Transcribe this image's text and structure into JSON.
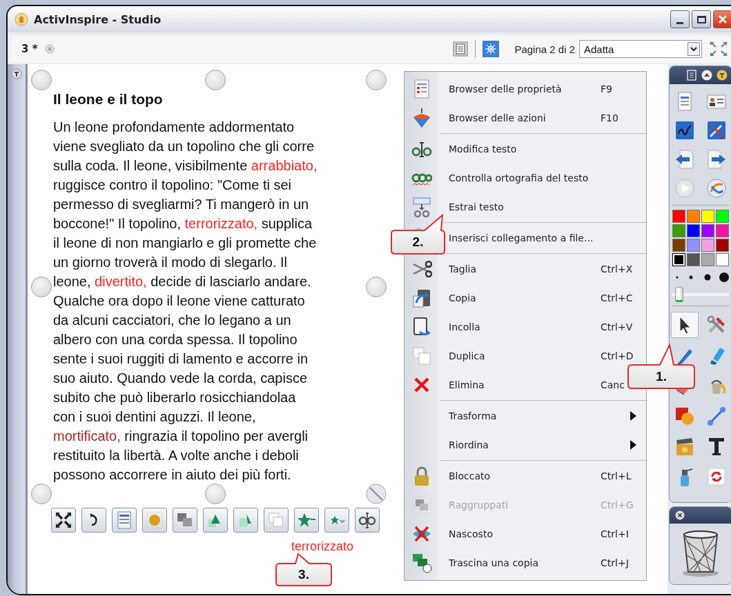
{
  "window": {
    "title": "ActivInspire - Studio"
  },
  "tab": {
    "label": "3 *"
  },
  "page_indicator": "Pagina 2 di 2",
  "zoom": {
    "value": "Adatta"
  },
  "text_object": {
    "title": "Il leone e il topo",
    "paragraph": [
      {
        "text": "Un leone profondamente addormentato\nviene svegliato da un topolino che gli corre\nsulla coda. Il leone, visibilmente "
      },
      {
        "text": "arrabbiato,",
        "color": "#ff2020"
      },
      {
        "text": "\nruggisce contro il topolino: \"Come ti sei\npermesso di svegliarmi? Ti mangerò in un\nboccone!\" Il topolino, "
      },
      {
        "text": "terrorizzato,",
        "color": "#ff2020"
      },
      {
        "text": " supplica\nil leone di non mangiarlo e gli promette che\nun giorno troverà il modo di slegarlo. Il\nleone, "
      },
      {
        "text": "divertito,",
        "color": "#ff2020"
      },
      {
        "text": " decide di lasciarlo andare.\nQualche ora dopo il leone viene catturato\nda alcuni cacciatori, che lo legano a un\nalbero con una corda spessa. Il topolino\nsente i suoi ruggiti di lamento e accorre in\nsuo aiuto. Quando vede la corda, capisce\nsubito che può liberarlo rosicchiandolaa\ncon i suoi dentini aguzzi. Il leone,\n"
      },
      {
        "text": "mortificato,",
        "color": "#b42020"
      },
      {
        "text": " ringrazia il topolino per avergli\nrestituito la libertà. A volte anche i deboli\npossono accorrere in aiuto dei più forti."
      }
    ]
  },
  "dragged_text": "terrorizzato",
  "context_menu": {
    "groups": [
      [
        {
          "label": "Browser delle proprietà",
          "shortcut": "F9",
          "submenu": false,
          "disabled": false
        },
        {
          "label": "Browser delle azioni",
          "shortcut": "F10",
          "submenu": false,
          "disabled": false
        }
      ],
      [
        {
          "label": "Modifica testo",
          "submenu": false,
          "disabled": false
        },
        {
          "label": "Controlla ortografia del testo",
          "submenu": false,
          "disabled": false
        },
        {
          "label": "Estrai testo",
          "submenu": false,
          "disabled": false
        }
      ],
      [
        {
          "label": "Inserisci collegamento a file...",
          "submenu": false,
          "disabled": false
        }
      ],
      [
        {
          "label": "Taglia",
          "shortcut": "Ctrl+X",
          "submenu": false,
          "disabled": false
        },
        {
          "label": "Copia",
          "shortcut": "Ctrl+C",
          "submenu": false,
          "disabled": false
        },
        {
          "label": "Incolla",
          "shortcut": "Ctrl+V",
          "submenu": false,
          "disabled": false
        },
        {
          "label": "Duplica",
          "shortcut": "Ctrl+D",
          "submenu": false,
          "disabled": false
        },
        {
          "label": "Elimina",
          "shortcut": "Canc",
          "submenu": false,
          "disabled": false
        }
      ],
      [
        {
          "label": "Trasforma",
          "submenu": true,
          "disabled": false
        },
        {
          "label": "Riordina",
          "submenu": true,
          "disabled": false
        }
      ],
      [
        {
          "label": "Bloccato",
          "shortcut": "Ctrl+L",
          "submenu": false,
          "disabled": false
        },
        {
          "label": "Raggruppati",
          "shortcut": "Ctrl+G",
          "submenu": false,
          "disabled": true
        },
        {
          "label": "Nascosto",
          "shortcut": "Ctrl+I",
          "submenu": false,
          "disabled": false
        },
        {
          "label": "Trascina una copia",
          "shortcut": "Ctrl+J",
          "submenu": false,
          "disabled": false
        }
      ]
    ]
  },
  "callouts": [
    {
      "label": "1."
    },
    {
      "label": "2."
    },
    {
      "label": "3."
    }
  ],
  "toolbox": {
    "palette": [
      {
        "color": "#ff0000",
        "selected": false
      },
      {
        "color": "#ff8000",
        "selected": false
      },
      {
        "color": "#ffff00",
        "selected": false
      },
      {
        "color": "#00ff00",
        "selected": false
      },
      {
        "color": "#3c9c00",
        "selected": false
      },
      {
        "color": "#0000ff",
        "selected": false
      },
      {
        "color": "#a000ff",
        "selected": false
      },
      {
        "color": "#ff10a0",
        "selected": false
      },
      {
        "color": "#7a3c00",
        "selected": false
      },
      {
        "color": "#9090ff",
        "selected": false
      },
      {
        "color": "#f0a0e0",
        "selected": false
      },
      {
        "color": "#a00000",
        "selected": false
      },
      {
        "color": "#000000",
        "selected": true
      },
      {
        "color": "#555555",
        "selected": false
      },
      {
        "color": "#aaaaaa",
        "selected": false
      },
      {
        "color": "#ffffff",
        "selected": false
      }
    ],
    "pen_width": {
      "level": 0.06
    },
    "tools": [
      {
        "selected": true
      },
      {
        "selected": false
      },
      {
        "selected": false
      },
      {
        "selected": false
      },
      {
        "selected": false
      },
      {
        "selected": false
      },
      {
        "selected": false
      },
      {
        "selected": false
      },
      {
        "selected": false
      },
      {
        "selected": false
      },
      {
        "selected": false
      },
      {
        "selected": false
      }
    ]
  }
}
